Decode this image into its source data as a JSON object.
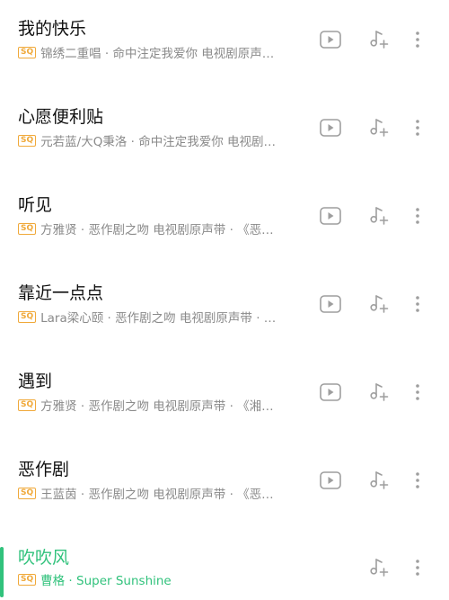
{
  "badge_label": "SQ",
  "colors": {
    "accent": "#31c27c",
    "badge": "#f0a93a",
    "title": "#111111",
    "meta": "#8a8a8a",
    "icon": "#9e9e9e"
  },
  "icons": {
    "play": "video-play-icon",
    "add": "add-to-playlist-icon",
    "more": "more-vertical-icon"
  },
  "songs": [
    {
      "title": "我的快乐",
      "meta": "锦绣二重唱 · 命中注定我爱你 电视剧原声…",
      "has_video": true
    },
    {
      "title": "心愿便利贴",
      "meta": "元若蓝/大Q秉洛 · 命中注定我爱你 电视剧…",
      "has_video": true
    },
    {
      "title": "听见",
      "meta": "方雅贤 · 恶作剧之吻 电视剧原声带 · 《恶…",
      "has_video": true
    },
    {
      "title": "靠近一点点",
      "meta": "Lara梁心颐 · 恶作剧之吻 电视剧原声带 · …",
      "has_video": true
    },
    {
      "title": "遇到",
      "meta": "方雅贤 · 恶作剧之吻 电视剧原声带 · 《湘…",
      "has_video": true
    },
    {
      "title": "恶作剧",
      "meta": "王蓝茵 · 恶作剧之吻 电视剧原声带 · 《恶…",
      "has_video": true
    },
    {
      "title": "吹吹风",
      "meta": "曹格 · Super Sunshine",
      "has_video": false,
      "active": true
    }
  ]
}
